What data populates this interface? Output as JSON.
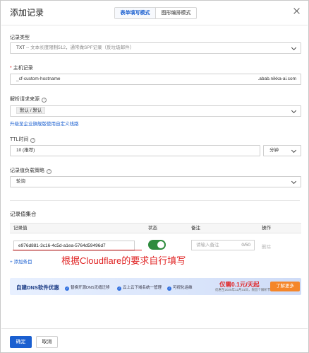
{
  "dialog": {
    "title": "添加记录",
    "tabs": [
      {
        "label": "表单填写模式",
        "active": true
      },
      {
        "label": "图形编排模式",
        "active": false
      }
    ]
  },
  "form": {
    "record_type": {
      "label": "记录类型",
      "value_code": "TXT",
      "value_desc": " -- 文本长度限制512，通常做SPF记录（反垃圾邮件）"
    },
    "hostname": {
      "required_mark": "*",
      "label": "主机记录",
      "value": "_cf-custom-hostname",
      "suffix": ".abab.nikka-ai.com"
    },
    "resolution_source": {
      "label": "解析请求来源",
      "value": "默认 / 默认",
      "upgrade_link": "升级至企业旗舰版使用自定义线路"
    },
    "ttl": {
      "label": "TTL时间",
      "value": "10 (推荐)",
      "unit": "分钟"
    },
    "load_strategy": {
      "label": "记录值负载策略",
      "value": "轮询"
    }
  },
  "records": {
    "section_title": "记录值集合",
    "columns": [
      "记录值",
      "状态",
      "备注",
      "操作"
    ],
    "row": {
      "value": "e976d881-3c16-4c5d-a1ea-5764d59496d7",
      "status_on": true,
      "note_placeholder": "请输入备注",
      "note_count": "0/50",
      "delete_label": "删除"
    },
    "add_label": "+ 添加条目",
    "annotation": "根据Cloudflare的要求自行填写"
  },
  "banner": {
    "title": "自建DNS软件优惠",
    "features": [
      "替换开源DNS无缝迁移",
      "云上云下域名统一管理",
      "可视化运维"
    ],
    "price": "仅需0.1元/天起",
    "sub": "优惠至2025年12月31日，限首个解析节点",
    "button": "了解更多"
  },
  "footer": {
    "confirm": "确定",
    "cancel": "取消"
  },
  "colors": {
    "primary": "#1a5fd0",
    "toggle_on": "#2e8b3d",
    "annotation": "#e02424",
    "banner_button": "#f5862a"
  }
}
